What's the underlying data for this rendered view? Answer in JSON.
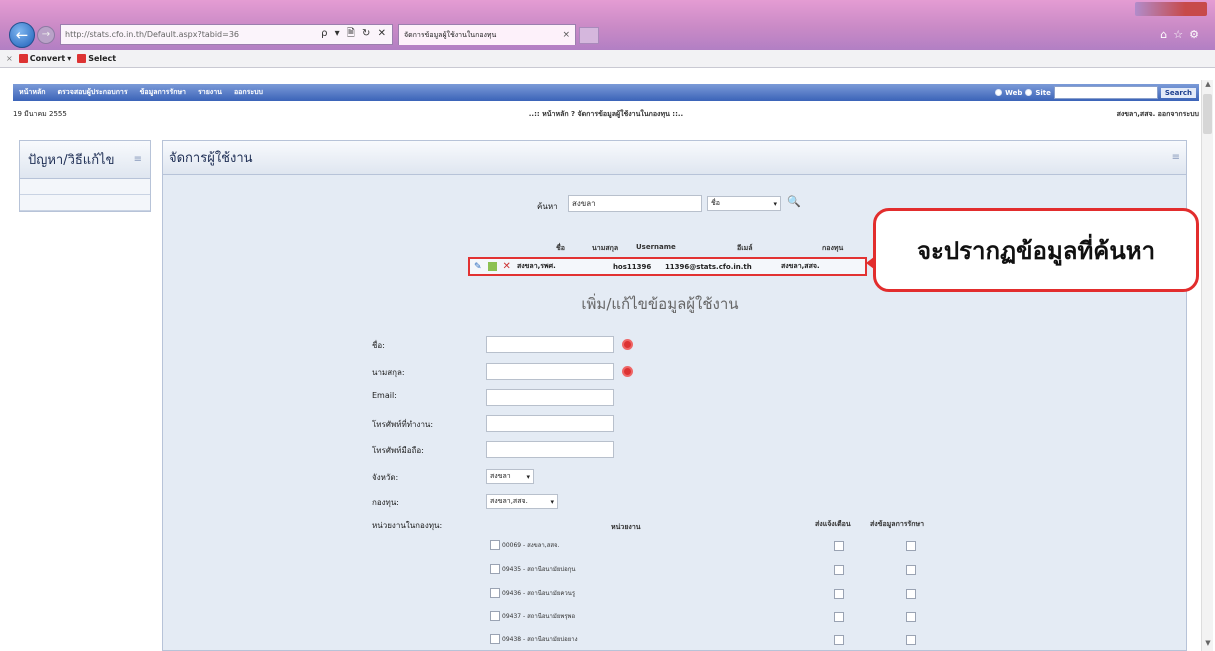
{
  "browser": {
    "url": "http://stats.cfo.in.th/Default.aspx?tabid=36",
    "address_tools": "ρ ▾ 🗎 ↻ ✕",
    "tab_title": "จัดการข้อมูลผู้ใช้งานในกองทุน",
    "commandbar": {
      "close": "×",
      "convert": "Convert",
      "select": "Select"
    }
  },
  "site": {
    "menu": [
      "หน้าหลัก",
      "ตรวจสอบผู้ประกอบการ",
      "ข้อมูลการรักษา",
      "รายงาน",
      "ออกระบบ"
    ],
    "search": {
      "web_label": "Web",
      "site_label": "Site",
      "button": "Search"
    },
    "date": "19 มีนาคม 2555",
    "breadcrumb": "..:: หน้าหลัก ? จัดการข้อมูลผู้ใช้งานในกองทุน ::..",
    "user": "สงขลา,สสจ. ออกจากระบบ"
  },
  "left_panel": {
    "title": "ปัญหา/วิธีแก้ไข",
    "collapse": "≡"
  },
  "main_panel": {
    "title": "จัดการผู้ใช้งาน",
    "collapse": "≡"
  },
  "search_form": {
    "label": "ค้นหา",
    "value": "สงขลา",
    "field_select": "ชื่อ"
  },
  "results": {
    "headers": [
      "ชื่อ",
      "นามสกุล",
      "Username",
      "อีเมล์",
      "กองทุน"
    ],
    "row": {
      "first_name": "สงขลา,รพศ.",
      "username": "hos11396",
      "email": "11396@stats.cfo.in.th",
      "fund": "สงขลา,สสจ."
    }
  },
  "callout": "จะปรากฏข้อมูลที่ค้นหา",
  "edit_form": {
    "title": "เพิ่ม/แก้ไขข้อมูลผู้ใช้งาน",
    "fields": {
      "first_name": "ชื่อ:",
      "last_name": "นามสกุล:",
      "email": "Email:",
      "work_phone": "โทรศัพท์ที่ทำงาน:",
      "mobile": "โทรศัพท์มือถือ:",
      "province": "จังหวัด:",
      "fund": "กองทุน:",
      "units": "หน่วยงานในกองทุน:"
    },
    "province_value": "สงขลา",
    "fund_value": "สงขลา,สสจ.",
    "units_table": {
      "head_unit": "หน่วยงาน",
      "head_notify": "ส่งแจ้งเตือน",
      "head_send": "ส่งข้อมูลการรักษา",
      "items": [
        "00069 - สงขลา,สสจ.",
        "09435 - สถานีอนามัยบ่อกุน",
        "09436 - สถานีอนามัยควนรู",
        "09437 - สถานีอนามัยพรุพอ",
        "09438 - สถานีอนามัยบ่อยาง"
      ]
    }
  }
}
